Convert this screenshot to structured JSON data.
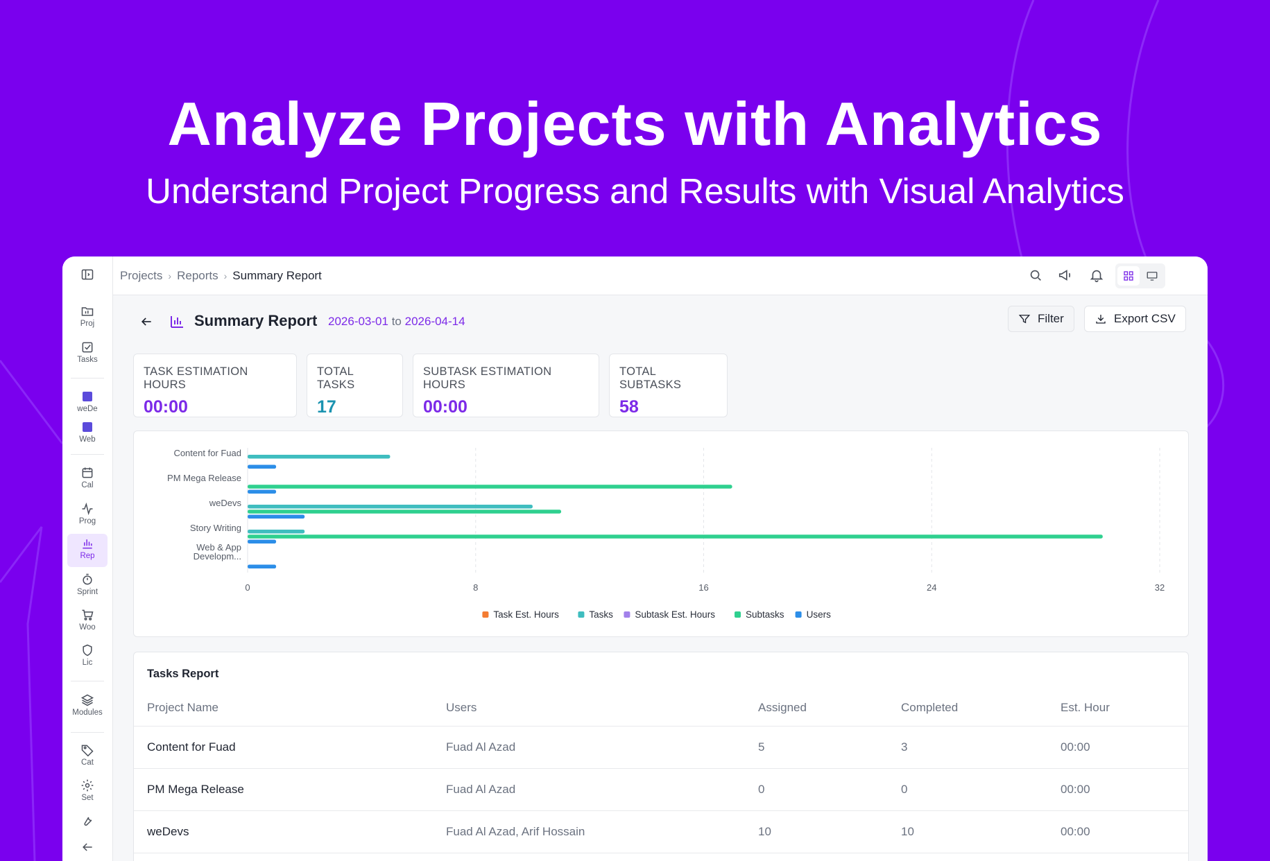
{
  "hero": {
    "title": "Analyze Projects with Analytics",
    "subtitle": "Understand Project Progress and Results with Visual Analytics"
  },
  "sidebar": {
    "items": [
      {
        "label": "",
        "icon": "sidebar-toggle-icon"
      },
      {
        "label": "Proj",
        "icon": "folder-icon"
      },
      {
        "label": "Tasks",
        "icon": "checkbox-icon"
      },
      {
        "label": "weDe",
        "icon": "square-icon"
      },
      {
        "label": "Web",
        "icon": "square-icon"
      },
      {
        "label": "Cal",
        "icon": "calendar-icon"
      },
      {
        "label": "Prog",
        "icon": "activity-icon"
      },
      {
        "label": "Rep",
        "icon": "bar-chart-icon"
      },
      {
        "label": "Sprint",
        "icon": "timer-icon"
      },
      {
        "label": "Woo",
        "icon": "cart-icon"
      },
      {
        "label": "Lic",
        "icon": "shield-icon"
      },
      {
        "label": "Modules",
        "icon": "layers-icon"
      },
      {
        "label": "Cat",
        "icon": "tag-icon"
      },
      {
        "label": "Set",
        "icon": "gear-icon"
      },
      {
        "label": "",
        "icon": "wrench-icon"
      },
      {
        "label": "",
        "icon": "arrow-left-icon"
      }
    ],
    "active": "Rep",
    "accent": "#7c2ae8"
  },
  "breadcrumb": [
    "Projects",
    "Reports",
    "Summary Report"
  ],
  "page": {
    "title": "Summary Report",
    "date_from": "2026-03-01",
    "date_to_word": "to",
    "date_to": "2026-04-14",
    "filter_label": "Filter",
    "export_label": "Export CSV"
  },
  "stats": [
    {
      "label": "TASK ESTIMATION HOURS",
      "value": "00:00"
    },
    {
      "label": "TOTAL TASKS",
      "value": "17"
    },
    {
      "label": "SUBTASK ESTIMATION HOURS",
      "value": "00:00"
    },
    {
      "label": "TOTAL SUBTASKS",
      "value": "58"
    }
  ],
  "chart_data": {
    "type": "bar",
    "orientation": "horizontal",
    "categories": [
      "Content for Fuad",
      "PM Mega Release",
      "weDevs",
      "Story Writing",
      "Web & App Developm..."
    ],
    "series": [
      {
        "name": "Task Est. Hours",
        "color": "#f47c32",
        "values": [
          0,
          0,
          0,
          0,
          0
        ]
      },
      {
        "name": "Tasks",
        "color": "#3fbdbf",
        "values": [
          5,
          0,
          10,
          2,
          0
        ]
      },
      {
        "name": "Subtask Est. Hours",
        "color": "#a281ea",
        "values": [
          0,
          0,
          0,
          0,
          0
        ]
      },
      {
        "name": "Subtasks",
        "color": "#2fd08f",
        "values": [
          0,
          17,
          11,
          30,
          0
        ]
      },
      {
        "name": "Users",
        "color": "#2c8ee8",
        "values": [
          1,
          1,
          2,
          1,
          1
        ]
      }
    ],
    "xticks": [
      "0",
      "8",
      "16",
      "24",
      "32"
    ],
    "xlim": [
      0,
      32
    ],
    "grid": true,
    "legend": "bottom"
  },
  "table": {
    "title": "Tasks Report",
    "columns": [
      "Project Name",
      "Users",
      "Assigned",
      "Completed",
      "Est. Hour"
    ],
    "rows": [
      [
        "Content for Fuad",
        "Fuad Al Azad",
        "5",
        "3",
        "00:00"
      ],
      [
        "PM Mega Release",
        "Fuad Al Azad",
        "0",
        "0",
        "00:00"
      ],
      [
        "weDevs",
        "Fuad Al Azad, Arif Hossain",
        "10",
        "10",
        "00:00"
      ]
    ]
  },
  "colors": {
    "background": "#7a00ee",
    "accent": "#7c2ae8",
    "teal_value": "#1b93b0"
  }
}
